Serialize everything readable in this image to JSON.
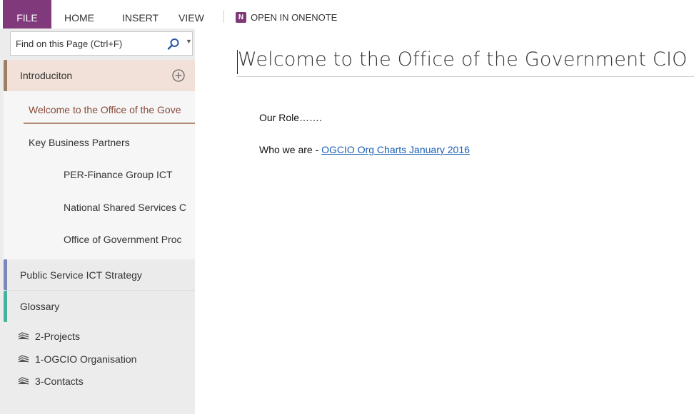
{
  "ribbon": {
    "tabs": [
      "FILE",
      "HOME",
      "INSERT",
      "VIEW"
    ],
    "open_in_onenote": "OPEN IN ONENOTE",
    "onenote_icon_letter": "N"
  },
  "sidebar": {
    "search_placeholder": "Find on this Page (Ctrl+F)",
    "sections": [
      {
        "label": "Introduciton",
        "color": "#9d7e67",
        "pages": [
          {
            "label": "Welcome to the Office of the Gove",
            "active": true
          },
          {
            "label": "Key Business Partners"
          },
          {
            "label": "PER-Finance Group ICT"
          },
          {
            "label": "National Shared Services C"
          },
          {
            "label": "Office of Government Proc"
          }
        ]
      },
      {
        "label": "Public Service ICT Strategy",
        "color": "#7a87bd"
      },
      {
        "label": "Glossary",
        "color": "#46b29b"
      }
    ],
    "section_groups": [
      "2-Projects",
      "1-OGCIO Organisation",
      "3-Contacts"
    ]
  },
  "page": {
    "title": "Welcome to the Office of the Government CIO",
    "line1": "Our Role…….",
    "line2_prefix": "Who we are - ",
    "line2_link": "OGCIO Org Charts January 2016"
  },
  "icons": {
    "search": "magnifier-icon",
    "add_page": "plus-circle-icon",
    "section_group": "stacked-sections-icon",
    "onenote": "onenote-logo-icon"
  }
}
